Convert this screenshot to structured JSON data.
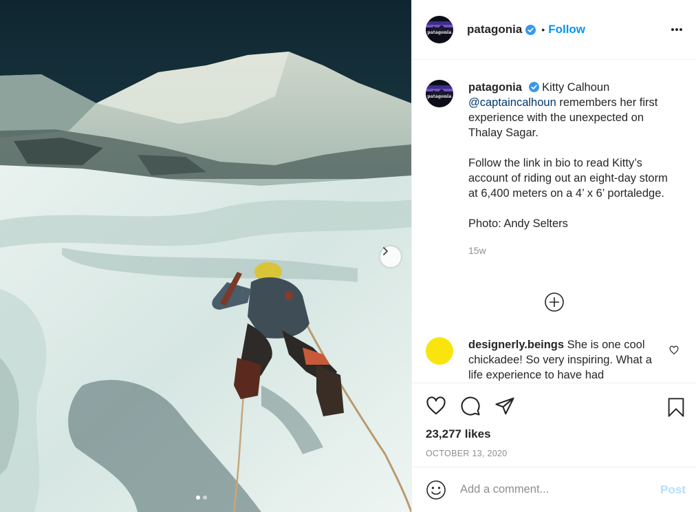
{
  "post": {
    "image_alt": "Climber ascending a snowy ice slope roped up below a rocky mountain face",
    "carousel": {
      "total": 2,
      "active_index": 0
    }
  },
  "header": {
    "avatar_text": "patagonia",
    "username": "patagonia",
    "separator": "•",
    "follow_label": "Follow"
  },
  "caption": {
    "username": "patagonia",
    "text_before_mention": "Kitty Calhoun",
    "mention": "@captaincalhoun",
    "text_after_mention": "remembers her first experience with the unexpected on Thalay Sagar.",
    "paragraph_2": "Follow the link in bio to read Kitty’s account of riding out an eight-day storm at 6,400 meters on a 4’ x 6’ portaledge.",
    "paragraph_3": "Photo: Andy Selters",
    "age": "15w"
  },
  "comments": [
    {
      "username": "designerly.beings",
      "text": "She is one cool chickadee! So very inspiring. What a life experience to have had",
      "avatar_color": "#f9e50d"
    }
  ],
  "actions": {
    "likes": "23,277 likes",
    "date": "OCTOBER 13, 2020"
  },
  "add_comment": {
    "placeholder": "Add a comment...",
    "post_label": "Post"
  },
  "colors": {
    "accent": "#0095f6",
    "post_disabled": "#b2dffc",
    "text": "#262626",
    "muted": "#8e8e8e"
  },
  "icons": [
    "verified-icon",
    "more-options-icon",
    "chevron-right-icon",
    "plus-circle-icon",
    "heart-icon",
    "comment-icon",
    "share-icon",
    "bookmark-icon",
    "emoji-icon"
  ]
}
